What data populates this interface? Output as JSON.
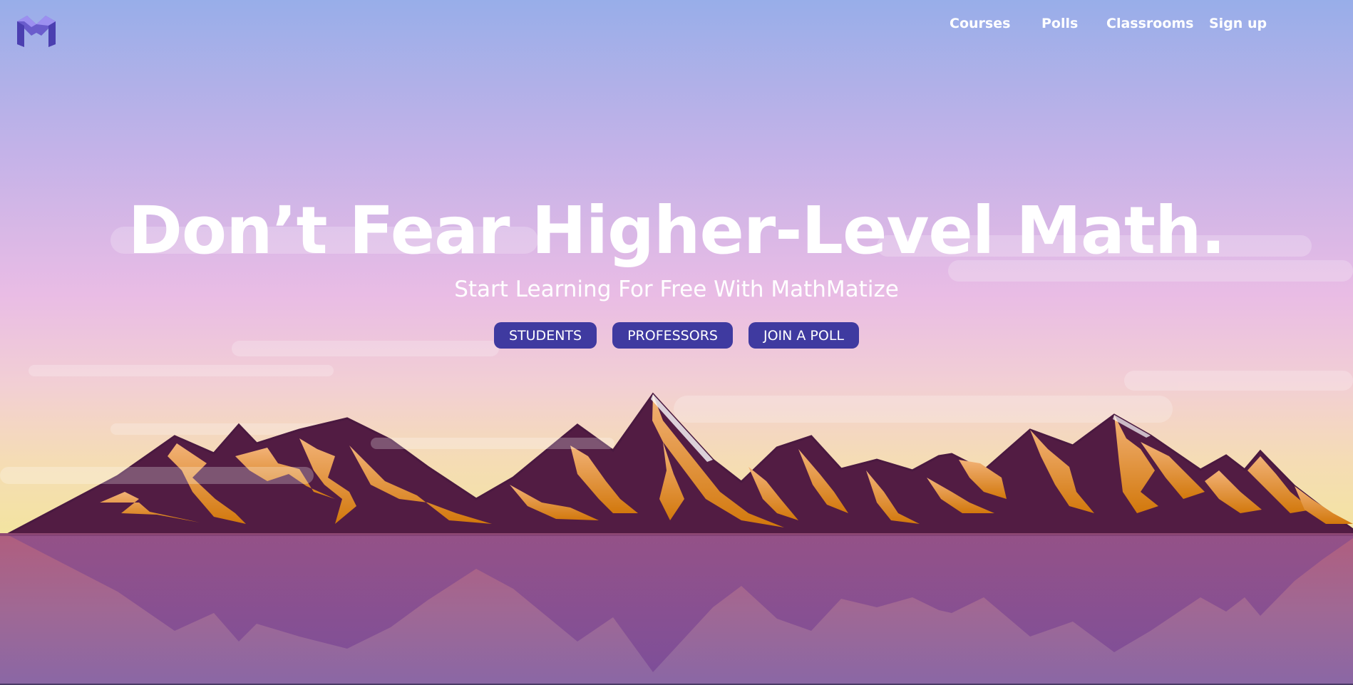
{
  "brand": {
    "logo_icon": "mathmatize-m-logo-icon"
  },
  "nav": {
    "items": [
      {
        "label": "Courses"
      },
      {
        "label": "Polls"
      },
      {
        "label": "Classrooms"
      },
      {
        "label": "Sign up"
      }
    ]
  },
  "hero": {
    "title": "Don’t Fear Higher-Level Math.",
    "subtitle": "Start Learning For Free With MathMatize",
    "buttons": [
      {
        "label": "STUDENTS"
      },
      {
        "label": "PROFESSORS"
      },
      {
        "label": "JOIN A POLL"
      }
    ]
  },
  "colors": {
    "sky_top": "#98aee9",
    "sky_mid": "#e8b6e3",
    "horizon": "#f4e4a3",
    "mountain": "#521c43",
    "snow": "#d07d15",
    "water": "#9a5d98",
    "button": "#3f3aa0"
  }
}
